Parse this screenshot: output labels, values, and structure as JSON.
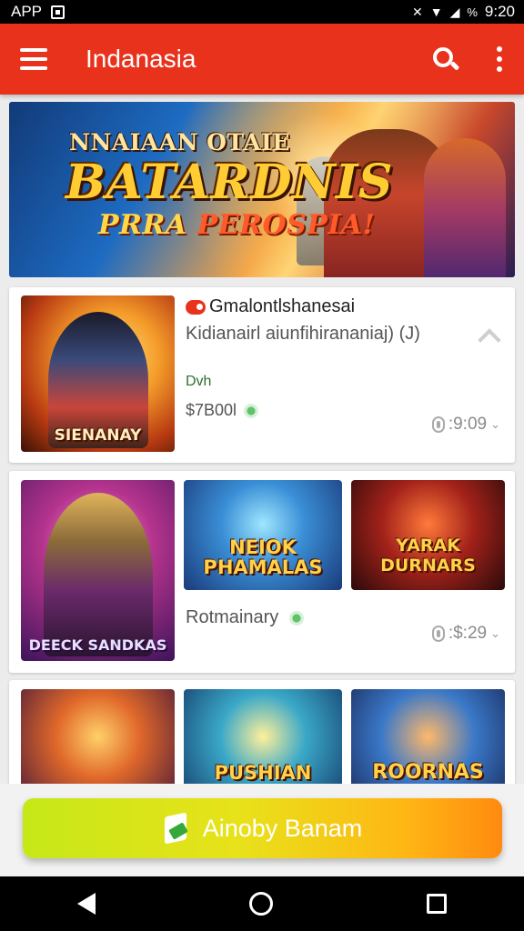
{
  "status_bar": {
    "carrier": "APP",
    "time": "9:20",
    "battery": "%"
  },
  "app_bar": {
    "title": "Indanasia"
  },
  "banner": {
    "line1": "NNAIAAN OTAIE",
    "line2": "BATARDNIS",
    "line3_a": "PRRA ",
    "line3_b": "PEROSPIA!"
  },
  "featured": {
    "thumb_caption": "SIENANAY",
    "title": "Gmalontlshanesai",
    "subtitle": "Kidianairl aiunfihirananiaj) (J)",
    "developer": "Dvh",
    "price": "$7B00l",
    "stat": ":9:09"
  },
  "row2": {
    "thumbs": [
      "DEECK SANDKAS",
      "NEIOK PHAMALAS",
      "YARAK DURNARS"
    ],
    "label": "Rotmainary",
    "stat": ":$:29"
  },
  "row3": {
    "thumbs": [
      "",
      "PUSHIAN",
      "ROORNAS"
    ]
  },
  "cta": {
    "label": "Ainoby Banam"
  },
  "colors": {
    "app_bar": "#e8321c",
    "cta_start": "#c6e817",
    "cta_end": "#ff8a10"
  }
}
